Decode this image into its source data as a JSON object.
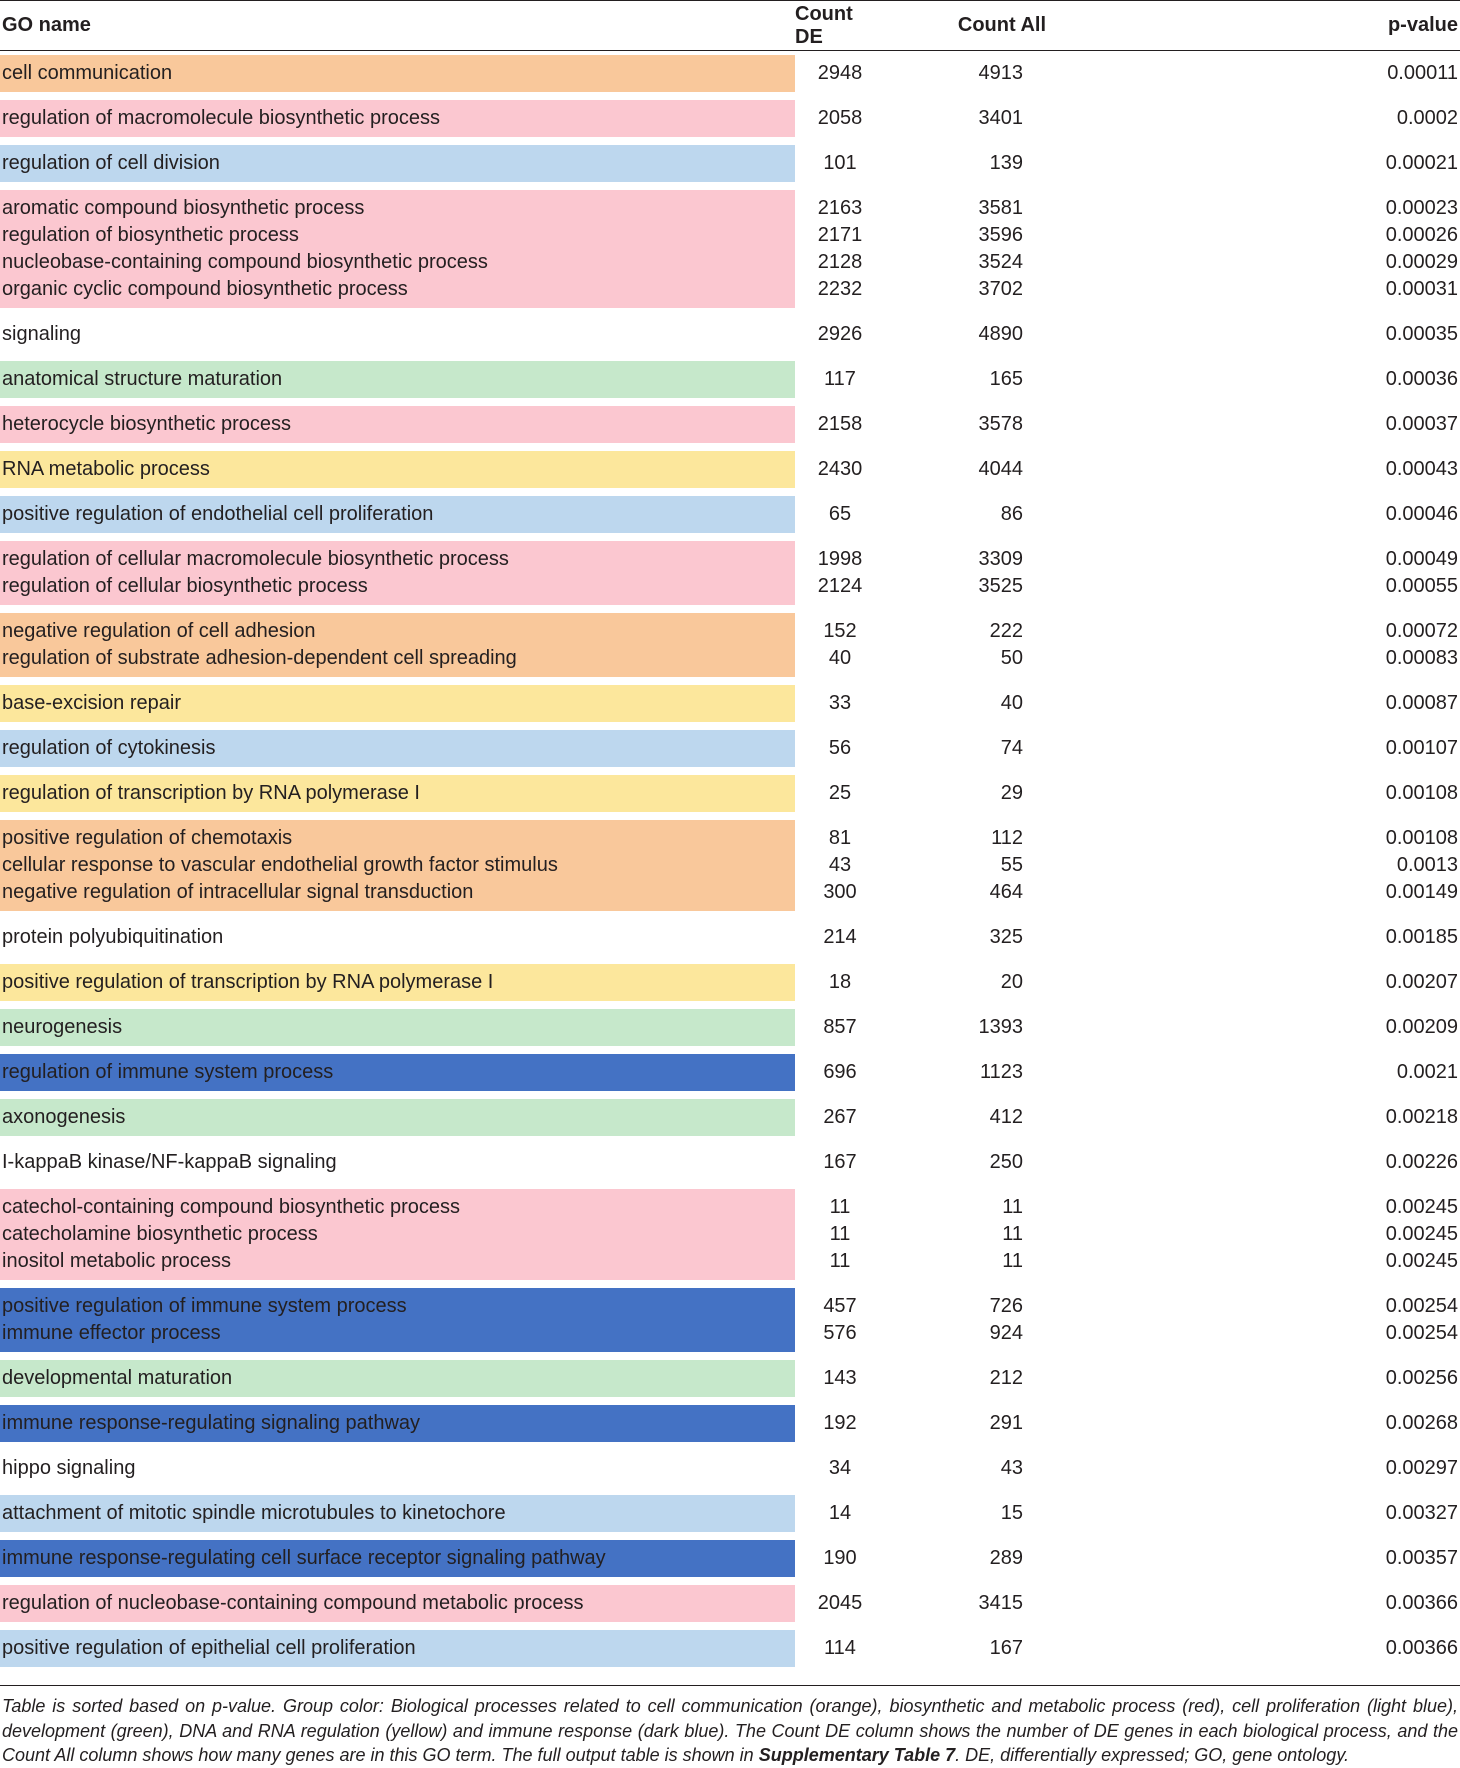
{
  "headers": {
    "name": "GO name",
    "count_de": "Count DE",
    "count_all": "Count All",
    "p_value": "p-value"
  },
  "colors": {
    "orange": "#f9c89b",
    "red": "#fbc7d0",
    "light_blue": "#bdd7ee",
    "green": "#c6e8cb",
    "yellow": "#fce79c",
    "dark_blue": "#4472c4",
    "none": "#ffffff"
  },
  "groups": [
    {
      "color": "orange",
      "rows": [
        [
          "cell communication",
          "2948",
          "4913",
          "0.00011"
        ]
      ]
    },
    {
      "color": "red",
      "rows": [
        [
          "regulation of macromolecule biosynthetic process",
          "2058",
          "3401",
          "0.0002"
        ]
      ]
    },
    {
      "color": "light_blue",
      "rows": [
        [
          "regulation of cell division",
          "101",
          "139",
          "0.00021"
        ]
      ]
    },
    {
      "color": "red",
      "rows": [
        [
          "aromatic compound biosynthetic process",
          "2163",
          "3581",
          "0.00023"
        ],
        [
          "regulation of biosynthetic process",
          "2171",
          "3596",
          "0.00026"
        ],
        [
          "nucleobase-containing compound biosynthetic process",
          "2128",
          "3524",
          "0.00029"
        ],
        [
          "organic cyclic compound biosynthetic process",
          "2232",
          "3702",
          "0.00031"
        ]
      ]
    },
    {
      "color": "none",
      "rows": [
        [
          "signaling",
          "2926",
          "4890",
          "0.00035"
        ]
      ]
    },
    {
      "color": "green",
      "rows": [
        [
          "anatomical structure maturation",
          "117",
          "165",
          "0.00036"
        ]
      ]
    },
    {
      "color": "red",
      "rows": [
        [
          "heterocycle biosynthetic process",
          "2158",
          "3578",
          "0.00037"
        ]
      ]
    },
    {
      "color": "yellow",
      "rows": [
        [
          "RNA metabolic process",
          "2430",
          "4044",
          "0.00043"
        ]
      ]
    },
    {
      "color": "light_blue",
      "rows": [
        [
          "positive regulation of endothelial cell proliferation",
          "65",
          "86",
          "0.00046"
        ]
      ]
    },
    {
      "color": "red",
      "rows": [
        [
          "regulation of cellular macromolecule biosynthetic process",
          "1998",
          "3309",
          "0.00049"
        ],
        [
          "regulation of cellular biosynthetic process",
          "2124",
          "3525",
          "0.00055"
        ]
      ]
    },
    {
      "color": "orange",
      "rows": [
        [
          "negative regulation of cell adhesion",
          "152",
          "222",
          "0.00072"
        ],
        [
          "regulation of substrate adhesion-dependent cell spreading",
          "40",
          "50",
          "0.00083"
        ]
      ]
    },
    {
      "color": "yellow",
      "rows": [
        [
          "base-excision repair",
          "33",
          "40",
          "0.00087"
        ]
      ]
    },
    {
      "color": "light_blue",
      "rows": [
        [
          "regulation of cytokinesis",
          "56",
          "74",
          "0.00107"
        ]
      ]
    },
    {
      "color": "yellow",
      "rows": [
        [
          "regulation of transcription by RNA polymerase I",
          "25",
          "29",
          "0.00108"
        ]
      ]
    },
    {
      "color": "orange",
      "rows": [
        [
          "positive regulation of chemotaxis",
          "81",
          "112",
          "0.00108"
        ],
        [
          "cellular response to vascular endothelial growth factor stimulus",
          "43",
          "55",
          "0.0013"
        ],
        [
          "negative regulation of intracellular signal transduction",
          "300",
          "464",
          "0.00149"
        ]
      ]
    },
    {
      "color": "none",
      "rows": [
        [
          "protein polyubiquitination",
          "214",
          "325",
          "0.00185"
        ]
      ]
    },
    {
      "color": "yellow",
      "rows": [
        [
          "positive regulation of transcription by RNA polymerase I",
          "18",
          "20",
          "0.00207"
        ]
      ]
    },
    {
      "color": "green",
      "rows": [
        [
          "neurogenesis",
          "857",
          "1393",
          "0.00209"
        ]
      ]
    },
    {
      "color": "dark_blue",
      "rows": [
        [
          "regulation of immune system process",
          "696",
          "1123",
          "0.0021"
        ]
      ]
    },
    {
      "color": "green",
      "rows": [
        [
          "axonogenesis",
          "267",
          "412",
          "0.00218"
        ]
      ]
    },
    {
      "color": "none",
      "rows": [
        [
          "I-kappaB kinase/NF-kappaB signaling",
          "167",
          "250",
          "0.00226"
        ]
      ]
    },
    {
      "color": "red",
      "rows": [
        [
          "catechol-containing compound biosynthetic process",
          "11",
          "11",
          "0.00245"
        ],
        [
          "catecholamine biosynthetic process",
          "11",
          "11",
          "0.00245"
        ],
        [
          "inositol metabolic process",
          "11",
          "11",
          "0.00245"
        ]
      ]
    },
    {
      "color": "dark_blue",
      "rows": [
        [
          "positive regulation of immune system process",
          "457",
          "726",
          "0.00254"
        ],
        [
          "immune effector process",
          "576",
          "924",
          "0.00254"
        ]
      ]
    },
    {
      "color": "green",
      "rows": [
        [
          "developmental maturation",
          "143",
          "212",
          "0.00256"
        ]
      ]
    },
    {
      "color": "dark_blue",
      "rows": [
        [
          "immune response-regulating signaling pathway",
          "192",
          "291",
          "0.00268"
        ]
      ]
    },
    {
      "color": "none",
      "rows": [
        [
          "hippo signaling",
          "34",
          "43",
          "0.00297"
        ]
      ]
    },
    {
      "color": "light_blue",
      "rows": [
        [
          "attachment of mitotic spindle microtubules to kinetochore",
          "14",
          "15",
          "0.00327"
        ]
      ]
    },
    {
      "color": "dark_blue",
      "rows": [
        [
          "immune response-regulating cell surface receptor signaling pathway",
          "190",
          "289",
          "0.00357"
        ]
      ]
    },
    {
      "color": "red",
      "rows": [
        [
          "regulation of nucleobase-containing compound metabolic process",
          "2045",
          "3415",
          "0.00366"
        ]
      ]
    },
    {
      "color": "light_blue",
      "rows": [
        [
          "positive regulation of epithelial cell proliferation",
          "114",
          "167",
          "0.00366"
        ]
      ]
    }
  ],
  "footnote": {
    "text_1": "Table is sorted based on p-value. Group color: Biological processes related to cell communication (orange), biosynthetic and metabolic process (red), cell proliferation (light blue), development (green), DNA and RNA regulation (yellow) and immune response (dark blue). The Count DE column shows the number of DE genes in each biological process, and the Count All column shows how many genes are in this GO term. The full output table is shown in ",
    "bold": "Supplementary Table 7",
    "text_2": ". DE, differentially expressed; GO, gene ontology."
  }
}
